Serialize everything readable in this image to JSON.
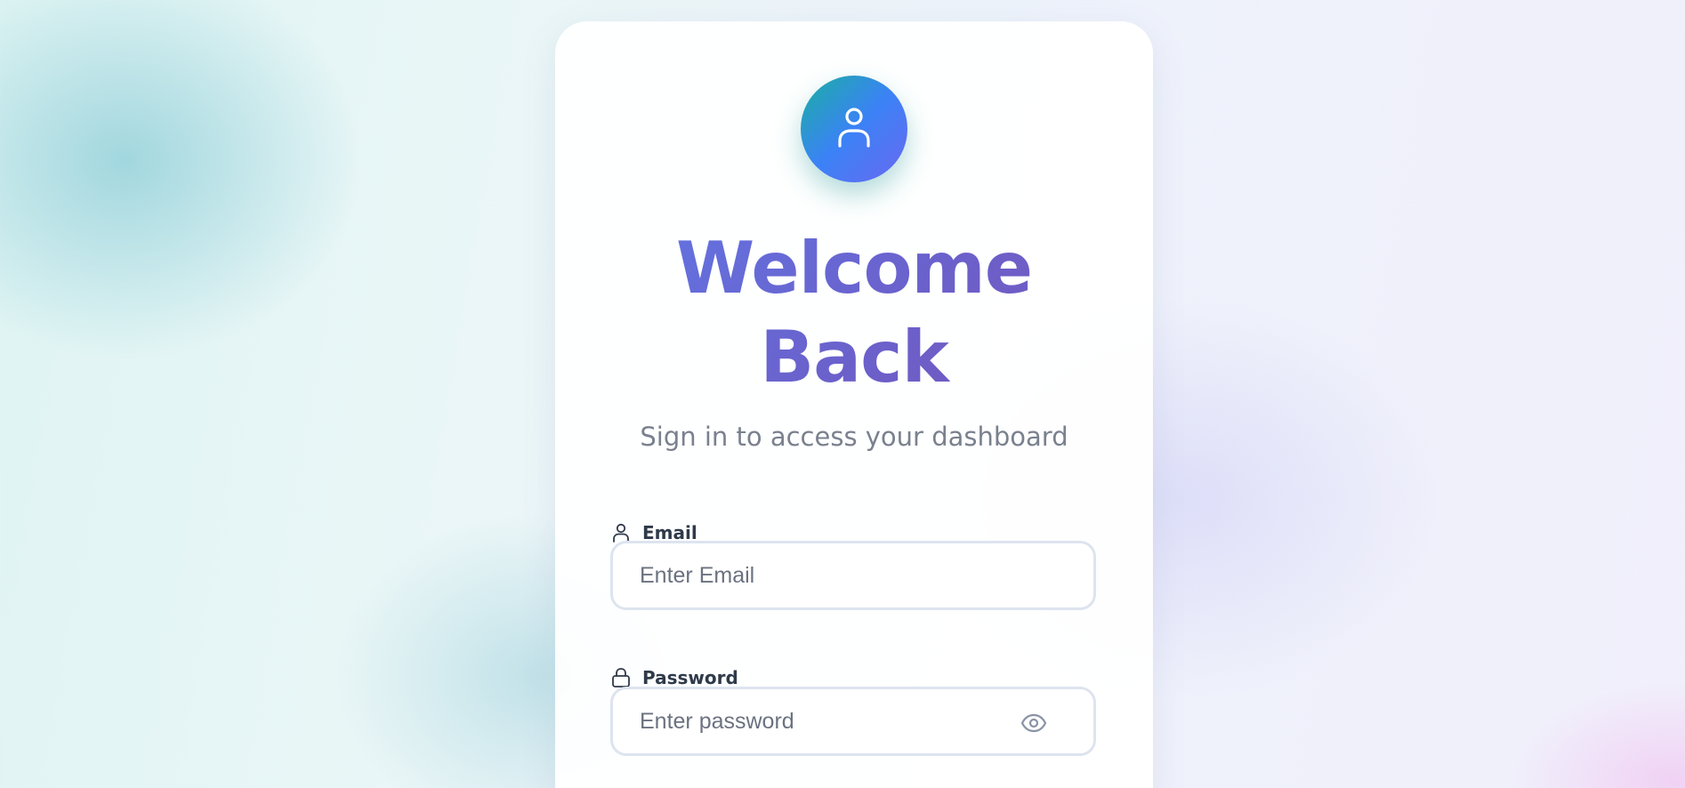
{
  "login": {
    "title_line1": "Welcome",
    "title_line2": "Back",
    "subtitle": "Sign in to access your dashboard",
    "email": {
      "label": "Email",
      "icon": "user-icon",
      "placeholder": "Enter Email",
      "value": ""
    },
    "password": {
      "label": "Password",
      "icon": "lock-icon",
      "placeholder": "Enter password",
      "value": "",
      "toggle_icon": "eye-icon"
    },
    "avatar_icon": "user-icon"
  },
  "colors": {
    "title_gradient_start": "#6077e6",
    "title_gradient_end": "#7a55b8",
    "avatar_gradient_start": "#1ab0a0",
    "avatar_gradient_end": "#6a68f0",
    "subtitle": "#7a818e",
    "input_border": "#dde4ef",
    "label": "#2f3a4a"
  }
}
